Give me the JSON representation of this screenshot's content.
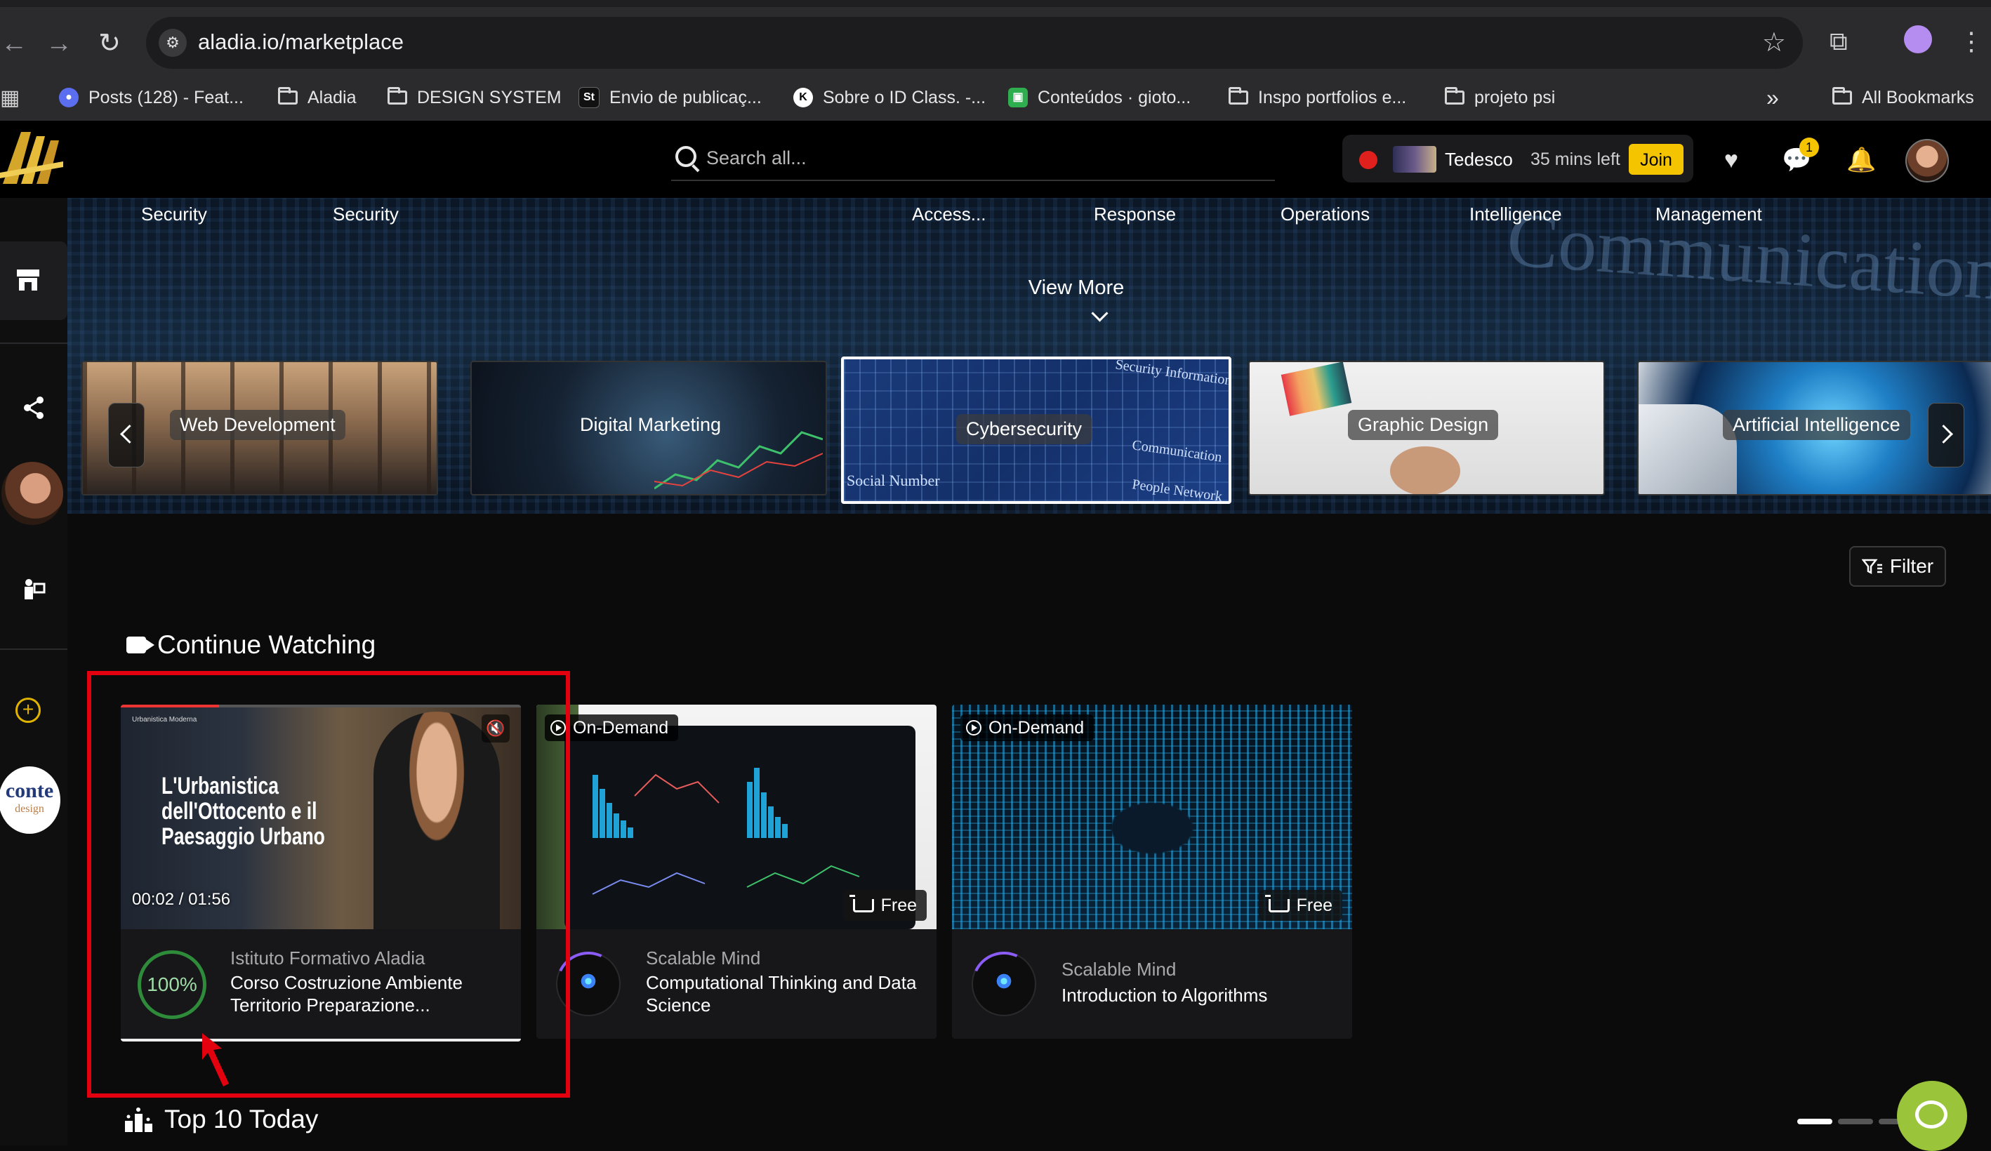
{
  "browser": {
    "url": "aladia.io/marketplace",
    "bookmarks": [
      {
        "label": "Posts (128) - Feat...",
        "type": "favicon"
      },
      {
        "label": "Aladia",
        "type": "folder"
      },
      {
        "label": "DESIGN SYSTEM",
        "type": "folder"
      },
      {
        "label": "Envio de publicaç...",
        "type": "favicon"
      },
      {
        "label": "Sobre o ID Class. -...",
        "type": "favicon"
      },
      {
        "label": "Conteúdos · gioto...",
        "type": "favicon"
      },
      {
        "label": "Inspo portfolios e...",
        "type": "folder"
      },
      {
        "label": "projeto psi",
        "type": "folder"
      }
    ],
    "overflow_label": "»",
    "all_bookmarks": "All Bookmarks"
  },
  "header": {
    "search_placeholder": "Search all...",
    "live": {
      "name": "Tedesco",
      "time_left": "35 mins left",
      "join_label": "Join"
    },
    "messages_badge": "1"
  },
  "hero": {
    "top_labels": [
      "Security",
      "Security",
      "Access...",
      "Response",
      "Operations",
      "Intelligence",
      "Management"
    ],
    "bg_text": "Communication",
    "view_more": "View More",
    "categories": [
      {
        "label": "Web Development",
        "selected": false
      },
      {
        "label": "Digital Marketing",
        "selected": false
      },
      {
        "label": "Cybersecurity",
        "selected": true
      },
      {
        "label": "Graphic Design",
        "selected": false
      },
      {
        "label": "Artificial Intelligence",
        "selected": false
      }
    ],
    "cyber_texts": [
      "Security Information",
      "Communication",
      "Social Number",
      "People Network"
    ]
  },
  "filter_label": "Filter",
  "continue_watching": {
    "title": "Continue Watching",
    "cards": [
      {
        "school": "Istituto Formativo Aladia",
        "title": "Corso Costruzione Ambiente Territorio Preparazione...",
        "progress": "100%",
        "time": "00:02 / 01:56",
        "video_title": "L'Urbanistica dell'Ottocento e il Paesaggio Urbano",
        "video_caption": "Urbanistica Moderna"
      },
      {
        "badge": "On-Demand",
        "price": "Free",
        "school": "Scalable Mind",
        "title": "Computational Thinking and Data Science"
      },
      {
        "badge": "On-Demand",
        "price": "Free",
        "school": "Scalable Mind",
        "title": "Introduction to Algorithms"
      }
    ]
  },
  "top10": {
    "title": "Top 10 Today"
  },
  "sidebar_logo": {
    "main": "conte",
    "sub": "design"
  },
  "colors": {
    "accent": "#f5c400",
    "highlight": "#e3000f",
    "progress": "#2e8b3a"
  }
}
